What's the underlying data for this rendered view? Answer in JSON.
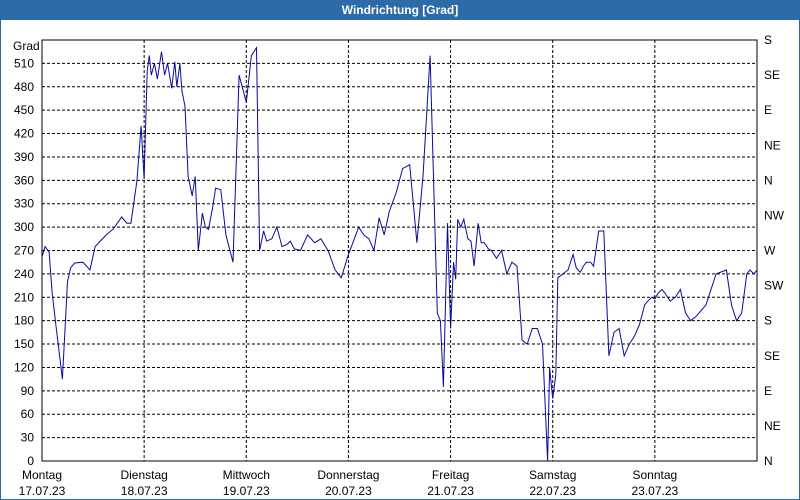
{
  "window": {
    "title": "Windrichtung [Grad]"
  },
  "chart_data": {
    "type": "line",
    "title": "Windrichtung [Grad]",
    "ylabel": "Grad",
    "ylim": [
      0,
      540
    ],
    "yticks": [
      0,
      30,
      60,
      90,
      120,
      150,
      180,
      210,
      240,
      270,
      300,
      330,
      360,
      390,
      420,
      450,
      480,
      510
    ],
    "right_ticks": [
      "N",
      "NE",
      "E",
      "SE",
      "S",
      "SW",
      "W",
      "NW",
      "N",
      "NE",
      "E",
      "SE",
      "S"
    ],
    "x_range": [
      0,
      7
    ],
    "days": [
      {
        "name": "Montag",
        "date": "17.07.23"
      },
      {
        "name": "Dienstag",
        "date": "18.07.23"
      },
      {
        "name": "Mittwoch",
        "date": "19.07.23"
      },
      {
        "name": "Donnerstag",
        "date": "20.07.23"
      },
      {
        "name": "Freitag",
        "date": "21.07.23"
      },
      {
        "name": "Samstag",
        "date": "22.07.23"
      },
      {
        "name": "Sonntag",
        "date": "23.07.23"
      }
    ],
    "grid": true,
    "line_color": "#0a0a9a",
    "series": [
      {
        "x": [
          0.0,
          0.03,
          0.07,
          0.1,
          0.14,
          0.2,
          0.25,
          0.28,
          0.32,
          0.4,
          0.47,
          0.52,
          0.57,
          0.63,
          0.7,
          0.78,
          0.83,
          0.87,
          0.93,
          0.97,
          1.0,
          1.03,
          1.05,
          1.07,
          1.1,
          1.13,
          1.17,
          1.2,
          1.23,
          1.27,
          1.3,
          1.32,
          1.35,
          1.37,
          1.4,
          1.43,
          1.47,
          1.5,
          1.53,
          1.57,
          1.6,
          1.63,
          1.67,
          1.7,
          1.75,
          1.8,
          1.87,
          1.93,
          2.0,
          2.05,
          2.1,
          2.13,
          2.17,
          2.2,
          2.25,
          2.3,
          2.35,
          2.4,
          2.43,
          2.47,
          2.53,
          2.6,
          2.67,
          2.73,
          2.8,
          2.87,
          2.93,
          3.0,
          3.05,
          3.1,
          3.15,
          3.2,
          3.25,
          3.3,
          3.35,
          3.4,
          3.47,
          3.53,
          3.6,
          3.67,
          3.73,
          3.8,
          3.87,
          3.9,
          3.93,
          3.97,
          4.0,
          4.03,
          4.05,
          4.07,
          4.1,
          4.13,
          4.17,
          4.2,
          4.23,
          4.27,
          4.3,
          4.33,
          4.37,
          4.4,
          4.45,
          4.5,
          4.55,
          4.6,
          4.65,
          4.7,
          4.75,
          4.8,
          4.85,
          4.9,
          4.95,
          4.97,
          5.0,
          5.03,
          5.05,
          5.1,
          5.15,
          5.2,
          5.23,
          5.27,
          5.3,
          5.33,
          5.37,
          5.4,
          5.45,
          5.5,
          5.55,
          5.6,
          5.65,
          5.7,
          5.75,
          5.8,
          5.85,
          5.9,
          5.93,
          5.97,
          6.0,
          6.03,
          6.07,
          6.1,
          6.15,
          6.2,
          6.25,
          6.3,
          6.35,
          6.4,
          6.5,
          6.6,
          6.7,
          6.75,
          6.8,
          6.85,
          6.9,
          6.93,
          6.97,
          7.0
        ],
        "y": [
          262,
          275,
          268,
          215,
          170,
          105,
          230,
          248,
          254,
          255,
          245,
          275,
          282,
          290,
          298,
          313,
          305,
          305,
          360,
          430,
          362,
          500,
          520,
          495,
          510,
          490,
          525,
          495,
          510,
          478,
          512,
          480,
          510,
          475,
          455,
          365,
          340,
          365,
          270,
          318,
          300,
          297,
          325,
          350,
          348,
          290,
          255,
          495,
          460,
          520,
          530,
          270,
          295,
          282,
          285,
          300,
          275,
          278,
          282,
          272,
          270,
          290,
          280,
          285,
          270,
          245,
          235,
          265,
          282,
          300,
          290,
          285,
          270,
          312,
          290,
          320,
          345,
          375,
          380,
          280,
          365,
          520,
          190,
          180,
          95,
          305,
          170,
          255,
          233,
          310,
          300,
          310,
          285,
          282,
          250,
          305,
          280,
          280,
          272,
          270,
          260,
          270,
          240,
          255,
          250,
          155,
          150,
          170,
          170,
          150,
          0,
          120,
          80,
          110,
          235,
          240,
          245,
          265,
          248,
          242,
          250,
          255,
          255,
          250,
          295,
          295,
          135,
          165,
          170,
          135,
          150,
          160,
          175,
          200,
          205,
          210,
          208,
          215,
          220,
          215,
          205,
          210,
          220,
          190,
          180,
          185,
          200,
          240,
          245,
          200,
          180,
          190,
          240,
          245,
          240,
          245
        ]
      }
    ]
  }
}
